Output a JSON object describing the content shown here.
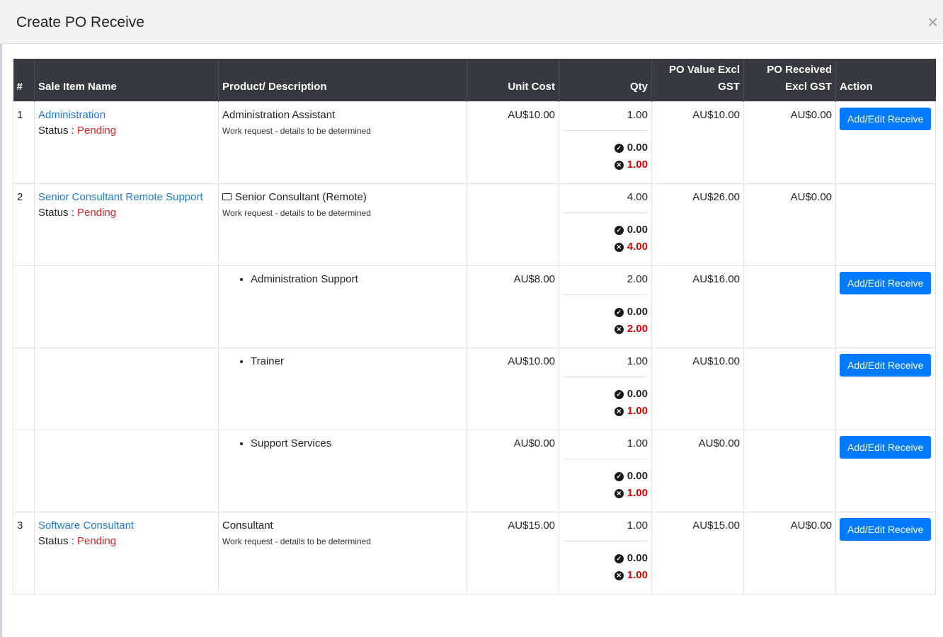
{
  "modal": {
    "title": "Create PO Receive",
    "close_icon": "×"
  },
  "table": {
    "headers": {
      "num": "#",
      "sale_item_name": "Sale Item Name",
      "product_description": "Product/ Description",
      "unit_cost": "Unit Cost",
      "qty": "Qty",
      "po_value_line1": "PO Value Excl",
      "po_value_line2": "GST",
      "po_received_line1": "PO Received",
      "po_received_line2": "Excl GST",
      "action": "Action"
    },
    "status_label": "Status : ",
    "action_button_label": "Add/Edit Receive",
    "rows": [
      {
        "num": "1",
        "sale_item": "Administration",
        "status": "Pending",
        "product": "Administration Assistant",
        "description": "Work request - details to be determined",
        "unit_cost": "AU$10.00",
        "qty": "1.00",
        "qty_received": "0.00",
        "qty_pending": "1.00",
        "po_value": "AU$10.00",
        "po_received": "AU$0.00"
      },
      {
        "num": "2",
        "sale_item": "Senior Consultant Remote Support",
        "status": "Pending",
        "product": "Senior Consultant (Remote)",
        "description": "Work request - details to be determined",
        "unit_cost": "",
        "qty": "4.00",
        "qty_received": "0.00",
        "qty_pending": "4.00",
        "po_value": "AU$26.00",
        "po_received": "AU$0.00"
      },
      {
        "product": "Administration Support",
        "unit_cost": "AU$8.00",
        "qty": "2.00",
        "qty_received": "0.00",
        "qty_pending": "2.00",
        "po_value": "AU$16.00"
      },
      {
        "product": "Trainer",
        "unit_cost": "AU$10.00",
        "qty": "1.00",
        "qty_received": "0.00",
        "qty_pending": "1.00",
        "po_value": "AU$10.00"
      },
      {
        "product": "Support Services",
        "unit_cost": "AU$0.00",
        "qty": "1.00",
        "qty_received": "0.00",
        "qty_pending": "1.00",
        "po_value": "AU$0.00"
      },
      {
        "num": "3",
        "sale_item": "Software Consultant",
        "status": "Pending",
        "product": "Consultant",
        "description": "Work request - details to be determined",
        "unit_cost": "AU$15.00",
        "qty": "1.00",
        "qty_received": "0.00",
        "qty_pending": "1.00",
        "po_value": "AU$15.00",
        "po_received": "AU$0.00"
      }
    ]
  },
  "colors": {
    "header_bg": "#343a40",
    "link": "#1f7ad6",
    "pending": "#e02424",
    "qty_pending": "#e00000",
    "button": "#007bff"
  },
  "icons": {
    "check": "check-circle-icon",
    "cross": "times-circle-icon",
    "folder": "folder-icon",
    "close": "close-icon"
  }
}
